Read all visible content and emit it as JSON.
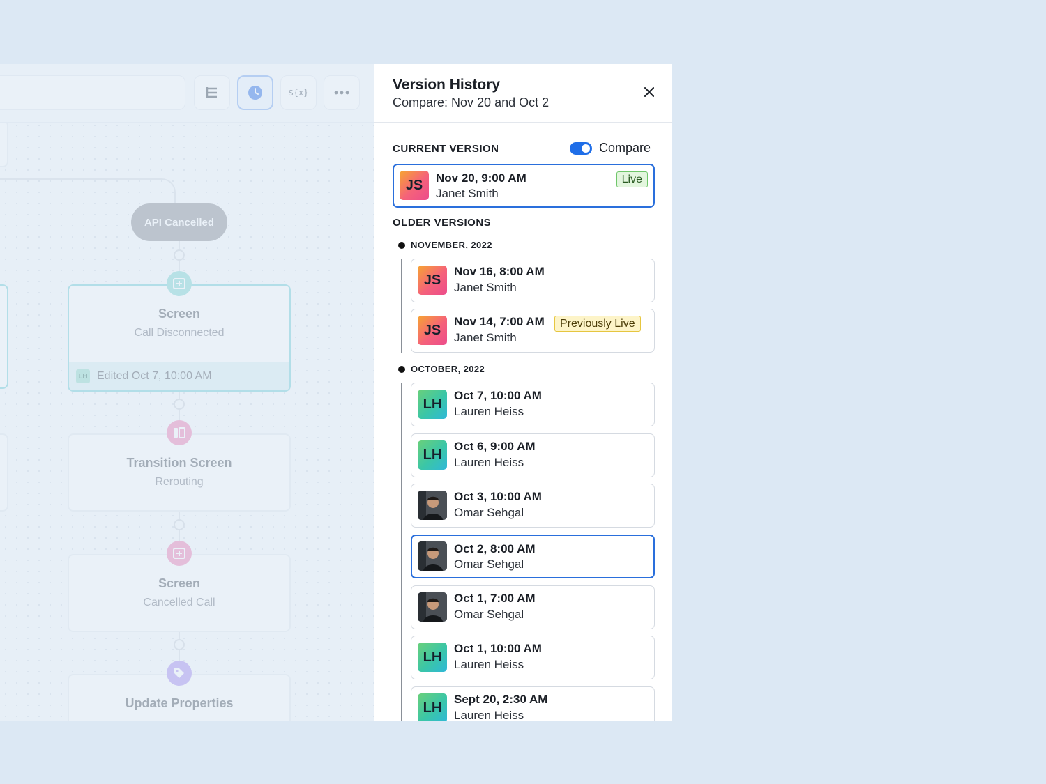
{
  "canvas": {
    "toolbar": {
      "outline_icon": "list-tree-icon",
      "history_icon": "clock-icon",
      "variables_label": "${x}",
      "more_icon": "more-horizontal-icon"
    },
    "pill_label": "API Cancelled",
    "nodes": [
      {
        "title": "Screen",
        "subtitle": "Call Disconnected",
        "footer": "Edited Oct 7, 10:00 AM",
        "footer_initials": "LH",
        "icon": "screen-icon"
      },
      {
        "title": "Transition Screen",
        "subtitle": "Rerouting",
        "icon": "transition-icon"
      },
      {
        "title": "Screen",
        "subtitle": "Cancelled Call",
        "icon": "screen-icon"
      },
      {
        "title": "Update Properties",
        "icon": "tag-icon"
      }
    ]
  },
  "panel": {
    "title": "Version History",
    "subtitle": "Compare: Nov 20 and Oct 2",
    "current_label": "CURRENT VERSION",
    "compare_label": "Compare",
    "compare_on": true,
    "current": {
      "date": "Nov 20, 9:00 AM",
      "name": "Janet Smith",
      "initials": "JS",
      "badge": "Live"
    },
    "older_label": "OLDER VERSIONS",
    "groups": [
      {
        "month": "NOVEMBER, 2022",
        "items": [
          {
            "date": "Nov 16, 8:00 AM",
            "name": "Janet Smith",
            "initials": "JS",
            "avatar": "js"
          },
          {
            "date": "Nov 14, 7:00 AM",
            "name": "Janet Smith",
            "initials": "JS",
            "avatar": "js",
            "badge": "Previously Live"
          }
        ]
      },
      {
        "month": "OCTOBER, 2022",
        "items": [
          {
            "date": "Oct 7, 10:00 AM",
            "name": "Lauren Heiss",
            "initials": "LH",
            "avatar": "lh"
          },
          {
            "date": "Oct 6, 9:00 AM",
            "name": "Lauren Heiss",
            "initials": "LH",
            "avatar": "lh"
          },
          {
            "date": "Oct 3, 10:00 AM",
            "name": "Omar Sehgal",
            "avatar": "photo"
          },
          {
            "date": "Oct 2, 8:00 AM",
            "name": "Omar Sehgal",
            "avatar": "photo",
            "selected": true
          },
          {
            "date": "Oct 1, 7:00 AM",
            "name": "Omar Sehgal",
            "avatar": "photo"
          },
          {
            "date": "Oct 1, 10:00 AM",
            "name": "Lauren Heiss",
            "initials": "LH",
            "avatar": "lh"
          },
          {
            "date": "Sept 20, 2:30 AM",
            "name": "Lauren Heiss",
            "initials": "LH",
            "avatar": "lh"
          }
        ]
      }
    ],
    "colors": {
      "accent": "#2a6fdc",
      "live_green": "#6fc66a",
      "prev_yellow": "#e6c640"
    }
  }
}
